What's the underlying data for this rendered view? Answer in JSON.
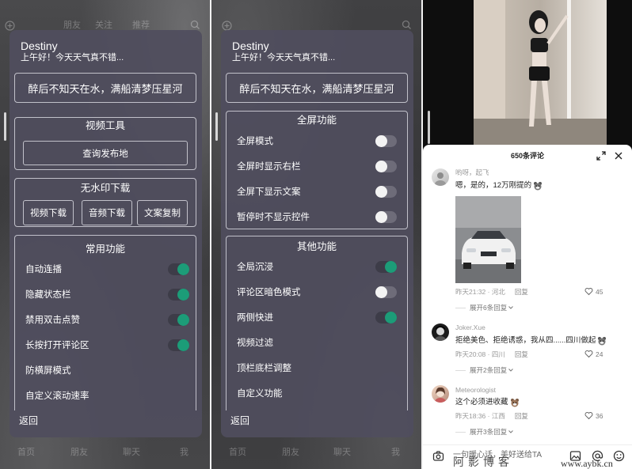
{
  "colors": {
    "card_bg": "#4f4e5e",
    "toggle_on": "#1c9c78",
    "toggle_off_knob": "#f3f3f3",
    "sheet_bg": "#ffffff",
    "meta_text": "#9a9a9a"
  },
  "left_panel": {
    "top_nav": [
      "朋友",
      "关注",
      "推荐"
    ],
    "bottom_nav": [
      "首页",
      "朋友",
      "聊天",
      "我"
    ],
    "card": {
      "title": "Destiny",
      "greeting": "上午好！今天天气真不错...",
      "motto": "醉后不知天在水，满船清梦压星河",
      "video_tools": {
        "title": "视频工具",
        "button": "查询发布地"
      },
      "download": {
        "title": "无水印下载",
        "buttons": [
          "视频下载",
          "音频下载",
          "文案复制"
        ]
      },
      "common": {
        "title": "常用功能",
        "items": [
          {
            "label": "自动连播",
            "toggle": "on"
          },
          {
            "label": "隐藏状态栏",
            "toggle": "on"
          },
          {
            "label": "禁用双击点赞",
            "toggle": "on"
          },
          {
            "label": "长按打开评论区",
            "toggle": "on"
          },
          {
            "label": "防横屏模式"
          },
          {
            "label": "自定义滚动速率"
          }
        ]
      },
      "back": "返回"
    }
  },
  "middle_panel": {
    "bottom_nav": [
      "首页",
      "朋友",
      "聊天",
      "我"
    ],
    "card": {
      "title": "Destiny",
      "greeting": "上午好！今天天气真不错...",
      "motto": "醉后不知天在水，满船清梦压星河",
      "fullscreen": {
        "title": "全屏功能",
        "items": [
          {
            "label": "全屏模式",
            "toggle": "off"
          },
          {
            "label": "全屏时显示右栏",
            "toggle": "off"
          },
          {
            "label": "全屏下显示文案",
            "toggle": "off"
          },
          {
            "label": "暂停时不显示控件",
            "toggle": "off"
          }
        ]
      },
      "other": {
        "title": "其他功能",
        "items": [
          {
            "label": "全局沉浸",
            "toggle": "on"
          },
          {
            "label": "评论区暗色模式",
            "toggle": "off"
          },
          {
            "label": "两侧快进",
            "toggle": "on"
          },
          {
            "label": "视频过滤"
          },
          {
            "label": "顶栏底栏调整"
          },
          {
            "label": "自定义功能"
          }
        ]
      },
      "back": "返回"
    }
  },
  "right_panel": {
    "comments_title": "650条评论",
    "comments": [
      {
        "user": "哟呀，起飞",
        "text": "嗯，是的，12万刚提的",
        "meta": "昨天21:32 · 河北",
        "reply": "回复",
        "likes": "45",
        "expand": "展开6条回复"
      },
      {
        "user": "Joker.Xue",
        "text": "拒绝美色、拒绝诱惑，我从四......四川做起",
        "meta": "昨天20:08 · 四川",
        "reply": "回复",
        "likes": "24",
        "expand": "展开2条回复"
      },
      {
        "user": "Meteorologist",
        "text": "这个必须进收藏",
        "meta": "昨天18:36 · 江西",
        "reply": "回复",
        "likes": "36",
        "expand": "展开3条回复"
      }
    ],
    "input_placeholder": "一句暖心话，美好送给TA",
    "watermark": {
      "name": "阿影博客",
      "url": "www.aybk.cn"
    }
  }
}
